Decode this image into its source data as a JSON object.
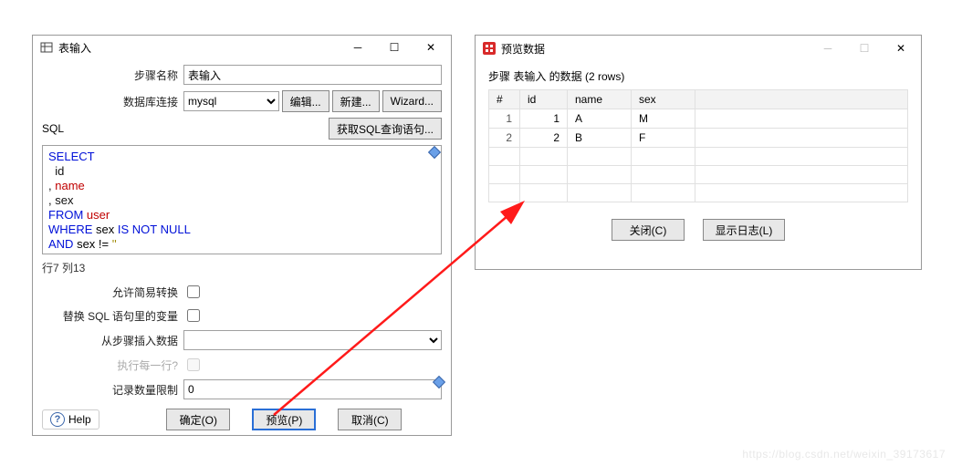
{
  "win1": {
    "title": "表输入",
    "stepNameLabel": "步骤名称",
    "stepNameValue": "表输入",
    "dbLabel": "数据库连接",
    "dbValue": "mysql",
    "editBtn": "编辑...",
    "newBtn": "新建...",
    "wizardBtn": "Wizard...",
    "sqlLabel": "SQL",
    "getSqlBtn": "获取SQL查询语句...",
    "sql_line1_kw": "SELECT",
    "sql_line2": "  id",
    "sql_line3_pre": ", ",
    "sql_line3_id": "name",
    "sql_line4": ", sex",
    "sql_line5_kw": "FROM",
    "sql_line5_sp": " ",
    "sql_line5_id": "user",
    "sql_line6_kw": "WHERE",
    "sql_line6_sp": " sex ",
    "sql_line6_kw2": "IS",
    "sql_line6_sp2": " ",
    "sql_line6_kw3": "NOT",
    "sql_line6_sp3": " ",
    "sql_line6_kw4": "NULL",
    "sql_line7_kw": "AND",
    "sql_line7_sp": " sex != ",
    "sql_line7_str": "''",
    "status": "行7 列13",
    "opt1": "允许简易转换",
    "opt2": "替换 SQL 语句里的变量",
    "opt3": "从步骤插入数据",
    "opt4": "执行每一行?",
    "opt5": "记录数量限制",
    "limitValue": "0",
    "help": "Help",
    "ok": "确定(O)",
    "preview": "预览(P)",
    "cancel": "取消(C)"
  },
  "win2": {
    "title": "预览数据",
    "subtitle": "步骤 表输入 的数据 (2 rows)",
    "cols": {
      "c0": "#",
      "c1": "id",
      "c2": "name",
      "c3": "sex"
    },
    "rows": [
      {
        "n": "1",
        "id": "1",
        "name": "A",
        "sex": "M"
      },
      {
        "n": "2",
        "id": "2",
        "name": "B",
        "sex": "F"
      }
    ],
    "close": "关闭(C)",
    "log": "显示日志(L)"
  },
  "watermark": "https://blog.csdn.net/weixin_39173617"
}
